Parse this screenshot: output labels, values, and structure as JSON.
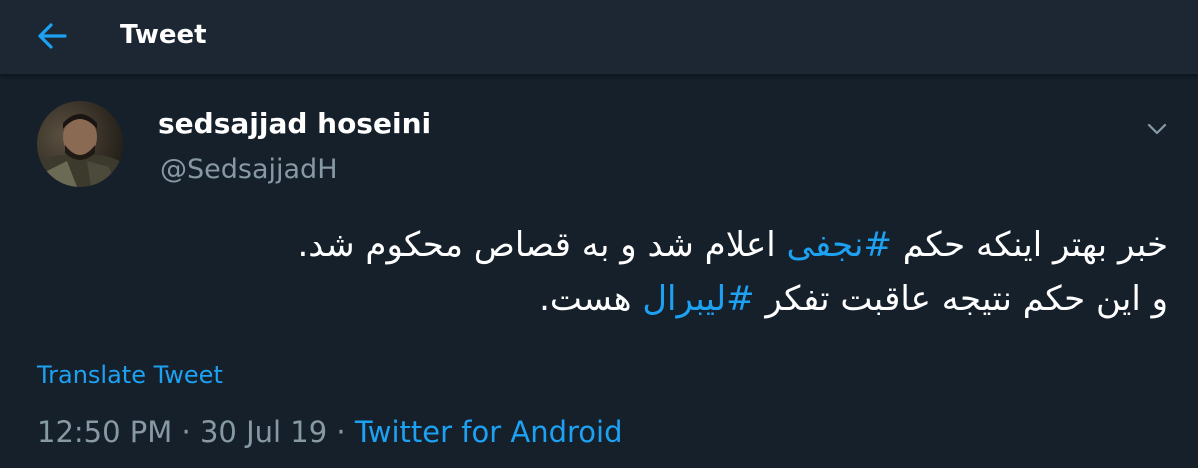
{
  "header": {
    "title": "Tweet",
    "back_icon": "arrow-left-icon"
  },
  "colors": {
    "background": "#15202b",
    "header_background": "#1c2733",
    "accent": "#1da1f2",
    "secondary_text": "#8899a6",
    "primary_text": "#ffffff"
  },
  "tweet": {
    "author": {
      "display_name": "sedsajjad hoseini",
      "handle": "@SedsajjadH"
    },
    "caret_icon": "chevron-down-icon",
    "lines": [
      {
        "before": "خبر بهتر اینکه حکم ",
        "hashtag": "#نجفی",
        "after": " اعلام شد و به قصاص محکوم شد."
      },
      {
        "before": "و این حکم نتیجه عاقبت تفکر ",
        "hashtag": "#لیبرال",
        "after": " هست."
      }
    ],
    "translate_label": "Translate Tweet",
    "time": "12:50 PM",
    "separator": "·",
    "date": "30 Jul 19",
    "source": "Twitter for Android"
  }
}
